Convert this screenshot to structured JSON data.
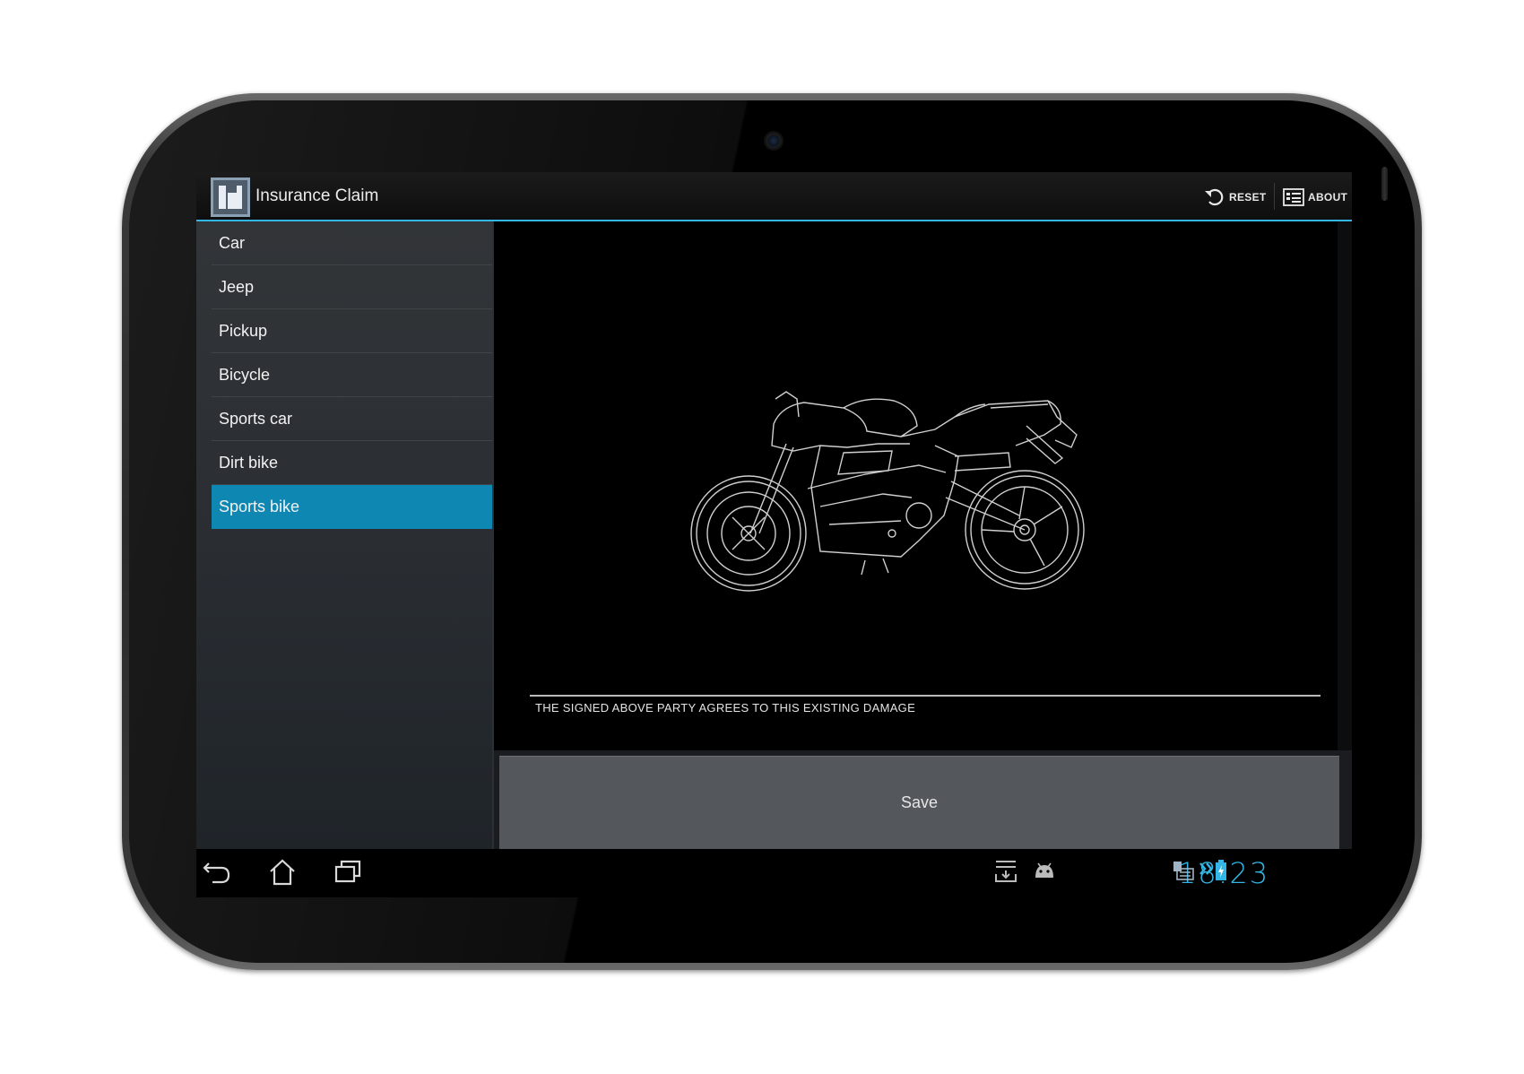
{
  "app": {
    "title": "Insurance Claim",
    "icon": "app-logo-icon"
  },
  "actions": {
    "reset_label": "RESET",
    "reset_icon": "undo-icon",
    "about_label": "ABOUT",
    "about_icon": "info-card-icon"
  },
  "vehicles": {
    "items": [
      {
        "label": "Car"
      },
      {
        "label": "Jeep"
      },
      {
        "label": "Pickup"
      },
      {
        "label": "Bicycle"
      },
      {
        "label": "Sports car"
      },
      {
        "label": "Dirt bike"
      },
      {
        "label": "Sports bike",
        "selected": true
      }
    ]
  },
  "diagram": {
    "image": "sports-bike-outline",
    "signature_text": "THE SIGNED ABOVE PARTY AGREES TO THIS EXISTING DAMAGE"
  },
  "save": {
    "label": "Save"
  },
  "system_bar": {
    "clock": "18:23",
    "nav_icons": [
      "back-icon",
      "home-icon",
      "recent-apps-icon"
    ],
    "status_icons": [
      "download-tray-icon",
      "android-icon",
      "keyboard-icon",
      "usb-debug-icon",
      "battery-charging-icon"
    ]
  },
  "colors": {
    "accent": "#33b5e5",
    "selected_item": "#0f87b3",
    "save_button": "#54585c"
  }
}
